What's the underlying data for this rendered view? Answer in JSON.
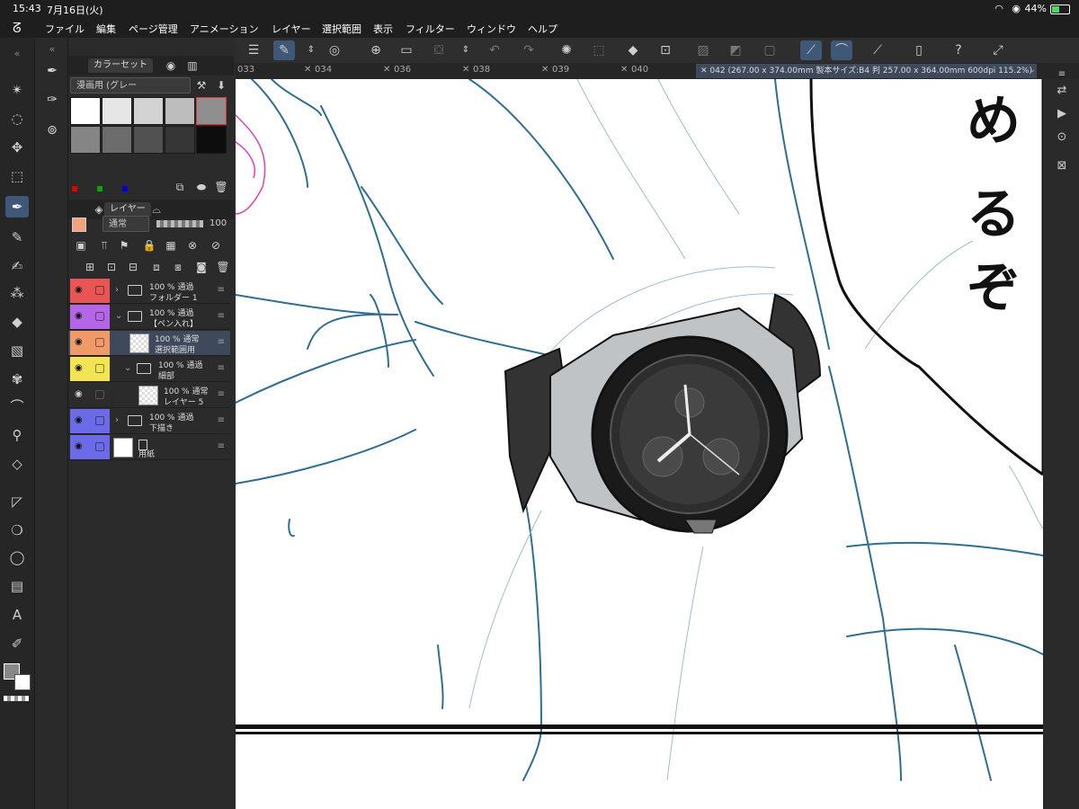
{
  "status_bar": {
    "time": "15:43",
    "date": "7月16日(火)",
    "battery": "44%"
  },
  "menu": [
    "ファイル",
    "編集",
    "ページ管理",
    "アニメーション",
    "レイヤー",
    "選択範囲",
    "表示",
    "フィルター",
    "ウィンドウ",
    "ヘルプ"
  ],
  "tools": [
    "magic-wand",
    "lasso",
    "move",
    "transform",
    "pen",
    "pencil",
    "brush",
    "airbrush",
    "fill",
    "gradient",
    "decoration",
    "figure",
    "eyedropper",
    "eraser",
    "ruler",
    "blend",
    "balloon",
    "frame",
    "text",
    "correction"
  ],
  "color_set": {
    "tab_label": "カラーセット",
    "selector": "漫画用 (グレー",
    "swatches": [
      "#ffffff",
      "#e6e6e6",
      "#d3d3d3",
      "#bdbdbd",
      "#8f8f8f",
      "#858585",
      "#6c6c6c",
      "#515151",
      "#363636",
      "#0d0d0d"
    ]
  },
  "layer_panel": {
    "tab_label": "レイヤー",
    "blend_mode": "通常",
    "opacity": "100",
    "layers": [
      {
        "line1": "100 % 通過",
        "line2": "フォルダー 1",
        "color": "#e85555",
        "type": "folder",
        "indent": 0,
        "collapsed": true
      },
      {
        "line1": "100 % 通過",
        "line2": "【ペン入れ】",
        "color": "#b566e6",
        "type": "folder",
        "indent": 0,
        "collapsed": false
      },
      {
        "line1": "100 % 通常",
        "line2": "選択範囲用",
        "color": "#f09a6a",
        "type": "raster",
        "indent": 1,
        "selected": true
      },
      {
        "line1": "100 % 通過",
        "line2": "細部",
        "color": "#f2e453",
        "type": "folder",
        "indent": 1,
        "collapsed": false
      },
      {
        "line1": "100 % 通常",
        "line2": "レイヤー 5",
        "color": "#2c2c2c",
        "type": "raster",
        "indent": 2
      },
      {
        "line1": "100 % 通過",
        "line2": "下描き",
        "color": "#6b6be8",
        "type": "folder",
        "indent": 0,
        "collapsed": true
      },
      {
        "line1": "",
        "line2": "用紙",
        "color": "#6b6be8",
        "type": "paper",
        "indent": 0
      }
    ]
  },
  "canvas_tabs": [
    "033",
    "034",
    "036",
    "038",
    "039",
    "040"
  ],
  "active_tab": "042 (267.00 x 374.00mm 製本サイズ:B4 判 257.00 x 364.00mm 600dpi 115.2%)",
  "manga_text": [
    "め",
    "る",
    "ぞ"
  ]
}
